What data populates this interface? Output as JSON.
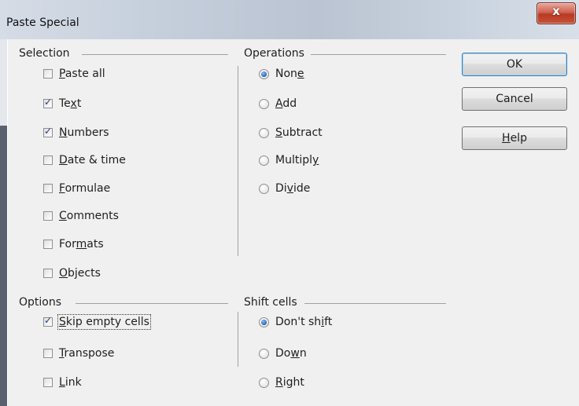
{
  "window": {
    "title": "Paste Special",
    "close_glyph": "x"
  },
  "selection": {
    "legend": "Selection",
    "items": [
      {
        "pre": "",
        "key": "P",
        "post": "aste all",
        "checked": false
      },
      {
        "pre": "Te",
        "key": "x",
        "post": "t",
        "checked": true
      },
      {
        "pre": "",
        "key": "N",
        "post": "umbers",
        "checked": true
      },
      {
        "pre": "",
        "key": "D",
        "post": "ate & time",
        "checked": false
      },
      {
        "pre": "",
        "key": "F",
        "post": "ormulae",
        "checked": false
      },
      {
        "pre": "",
        "key": "C",
        "post": "omments",
        "checked": false
      },
      {
        "pre": "For",
        "key": "m",
        "post": "ats",
        "checked": false
      },
      {
        "pre": "",
        "key": "O",
        "post": "bjects",
        "checked": false
      }
    ]
  },
  "operations": {
    "legend": "Operations",
    "items": [
      {
        "pre": "Non",
        "key": "e",
        "post": "",
        "selected": true
      },
      {
        "pre": "",
        "key": "A",
        "post": "dd",
        "selected": false
      },
      {
        "pre": "",
        "key": "S",
        "post": "ubtract",
        "selected": false
      },
      {
        "pre": "Multipl",
        "key": "y",
        "post": "",
        "selected": false
      },
      {
        "pre": "Di",
        "key": "v",
        "post": "ide",
        "selected": false
      }
    ]
  },
  "options": {
    "legend": "Options",
    "items": [
      {
        "pre": "",
        "key": "S",
        "post": "kip empty cells",
        "checked": true
      },
      {
        "pre": "",
        "key": "T",
        "post": "ranspose",
        "checked": false
      },
      {
        "pre": "",
        "key": "L",
        "post": "ink",
        "checked": false
      }
    ]
  },
  "shift_cells": {
    "legend": "Shift cells",
    "items": [
      {
        "pre": "Don't sh",
        "key": "i",
        "post": "ft",
        "selected": true
      },
      {
        "pre": "Do",
        "key": "w",
        "post": "n",
        "selected": false
      },
      {
        "pre": "",
        "key": "R",
        "post": "ight",
        "selected": false
      }
    ]
  },
  "buttons": {
    "ok": "OK",
    "cancel": "Cancel",
    "help_pre": "",
    "help_key": "H",
    "help_post": "elp"
  }
}
